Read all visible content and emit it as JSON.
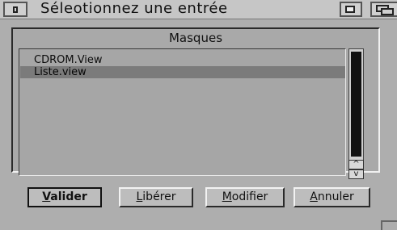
{
  "window": {
    "title": "Séleotionnez une entrée"
  },
  "group": {
    "title": "Masques"
  },
  "list": {
    "items": [
      {
        "label": "CDROM.View",
        "selected": false
      },
      {
        "label": "Liste.view",
        "selected": true
      }
    ]
  },
  "scrollbar": {
    "up_arrow": "^",
    "down_arrow": "v"
  },
  "buttons": {
    "validate": {
      "first": "V",
      "rest": "alider"
    },
    "release": {
      "first": "L",
      "rest": "ibérer"
    },
    "modify": {
      "first": "M",
      "rest": "odifier"
    },
    "cancel": {
      "first": "A",
      "rest": "nnuler"
    }
  },
  "icons": {
    "close": "close-gadget-icon",
    "zoom": "zoom-gadget-icon",
    "depth": "depth-gadget-icon"
  },
  "colors": {
    "background": "#aeaeae",
    "selection": "#7b7b7b",
    "scroll_knob": "#111111"
  }
}
